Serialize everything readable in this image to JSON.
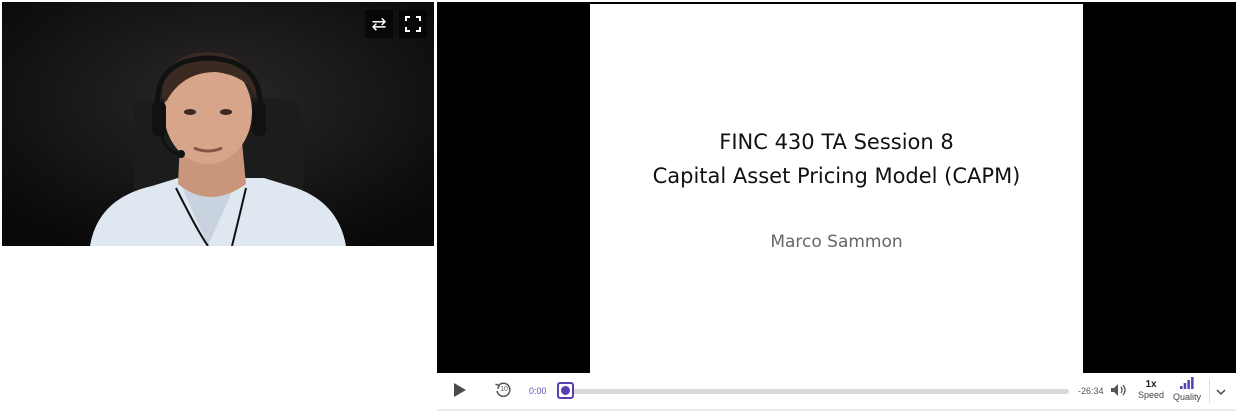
{
  "camera": {
    "swap_icon": "swap-arrows-icon",
    "fullscreen_icon": "fullscreen-icon"
  },
  "slide": {
    "title_line1": "FINC 430 TA Session 8",
    "title_line2": "Capital Asset Pricing Model (CAPM)",
    "author": "Marco Sammon"
  },
  "controls": {
    "play_icon": "play-icon",
    "rewind_icon": "rewind-10-icon",
    "rewind_number": "10",
    "current_time": "0:00",
    "remaining_time": "-26:34",
    "progress": 0,
    "volume_icon": "volume-icon",
    "speed_value": "1x",
    "speed_label": "Speed",
    "quality_icon": "signal-bars-icon",
    "quality_label": "Quality",
    "more_icon": "chevron-down-icon"
  },
  "colors": {
    "accent": "#5a3fb0",
    "time_text": "#5a4fb8",
    "stage_bg": "#000000"
  }
}
